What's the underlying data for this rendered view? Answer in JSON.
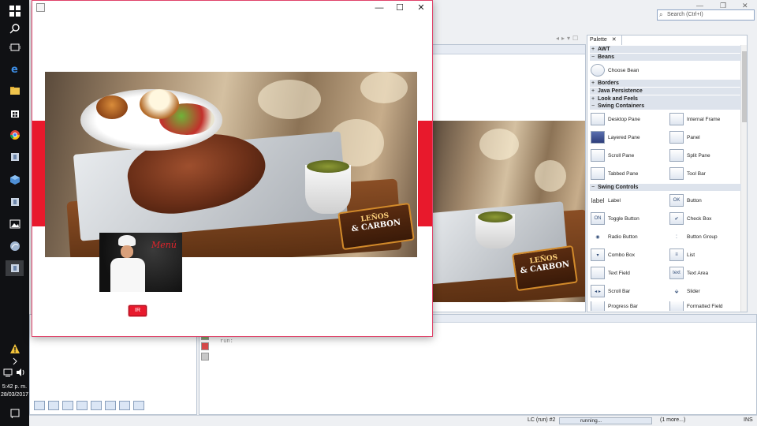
{
  "taskbar": {
    "time": "5:42 p. m.",
    "date": "28/03/2017",
    "icons": [
      "windows-start-icon",
      "search-icon",
      "task-view-icon",
      "edge-icon",
      "file-explorer-icon",
      "store-icon",
      "chrome-icon",
      "java-app-icon",
      "virtualbox-icon",
      "java-app-icon",
      "photos-icon",
      "java-app-icon",
      "java-app-icon",
      "warning-icon",
      "network-icon",
      "volume-icon",
      "notifications-icon"
    ]
  },
  "ide": {
    "search_placeholder": "Search (Ctrl+I)",
    "palette": {
      "tab_label": "Palette",
      "categories": [
        {
          "label": "AWT",
          "sign": "+"
        },
        {
          "label": "Beans",
          "sign": "−"
        },
        {
          "label": "Borders",
          "sign": "+"
        },
        {
          "label": "Java Persistence",
          "sign": "+"
        },
        {
          "label": "Look and Feels",
          "sign": "+"
        },
        {
          "label": "Swing Containers",
          "sign": "−"
        },
        {
          "label": "Swing Controls",
          "sign": "−"
        }
      ],
      "beans_items": [
        "Choose Bean"
      ],
      "containers_items": [
        "Desktop Pane",
        "Internal Frame",
        "Layered Pane",
        "Panel",
        "Scroll Pane",
        "Split Pane",
        "Tabbed Pane",
        "Tool Bar"
      ],
      "controls_items": [
        "Label",
        "Button",
        "Toggle Button",
        "Check Box",
        "Radio Button",
        "Button Group",
        "Combo Box",
        "List",
        "Text Field",
        "Text Area",
        "Scroll Bar",
        "Slider",
        "Progress Bar",
        "Formatted Field"
      ],
      "control_icon_text": {
        "label": "label",
        "button": "OK",
        "toggle": "ON",
        "textarea": "text"
      }
    },
    "output": {
      "text": "run:"
    },
    "status": {
      "lc": "LC (run) #2",
      "progress": "running...",
      "more": "(1 more...)",
      "ins": "INS"
    }
  },
  "app": {
    "close_glyph": "✕",
    "maximize_glyph": "☐",
    "minimize_glyph": "—",
    "logo_line1": "LEÑOS",
    "logo_line2": "& CARBON",
    "chef_caption": "Menú",
    "button_label": "IR",
    "accent_color": "#e8192c"
  }
}
